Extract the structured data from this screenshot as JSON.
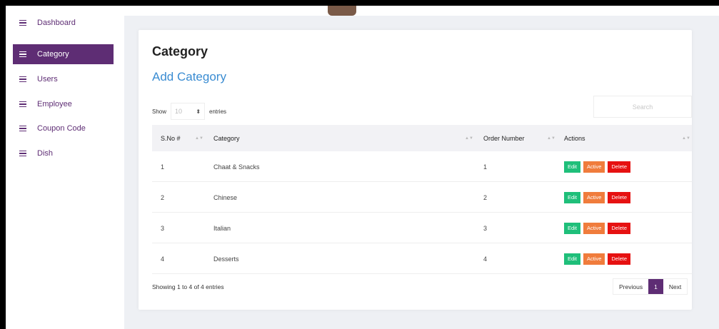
{
  "sidebar": {
    "items": [
      {
        "label": "Dashboard"
      },
      {
        "label": "Category"
      },
      {
        "label": "Users"
      },
      {
        "label": "Employee"
      },
      {
        "label": "Coupon Code"
      },
      {
        "label": "Dish"
      }
    ],
    "active_index": 1
  },
  "page": {
    "title": "Category",
    "add_link": "Add Category"
  },
  "table_controls": {
    "show_label": "Show",
    "length_value": "10",
    "entries_label": "entries",
    "search_placeholder": "Search"
  },
  "table": {
    "columns": [
      "S.No #",
      "Category",
      "Order Number",
      "Actions"
    ],
    "rows": [
      {
        "sno": "1",
        "category": "Chaat & Snacks",
        "order": "1"
      },
      {
        "sno": "2",
        "category": "Chinese",
        "order": "2"
      },
      {
        "sno": "3",
        "category": "Italian",
        "order": "3"
      },
      {
        "sno": "4",
        "category": "Desserts",
        "order": "4"
      }
    ],
    "actions": {
      "edit": "Edit",
      "active": "Active",
      "delete": "Delete"
    }
  },
  "footer": {
    "info": "Showing 1 to 4 of 4 entries",
    "previous": "Previous",
    "page": "1",
    "next": "Next"
  },
  "colors": {
    "brand": "#5e2d74",
    "link": "#3a8cd2",
    "edit": "#1fbf7a",
    "active": "#f07c3c",
    "delete": "#e61111"
  },
  "icons": {
    "nav": "menu-lines-icon",
    "sort": "sort-icon",
    "select": "select-arrows-icon"
  }
}
